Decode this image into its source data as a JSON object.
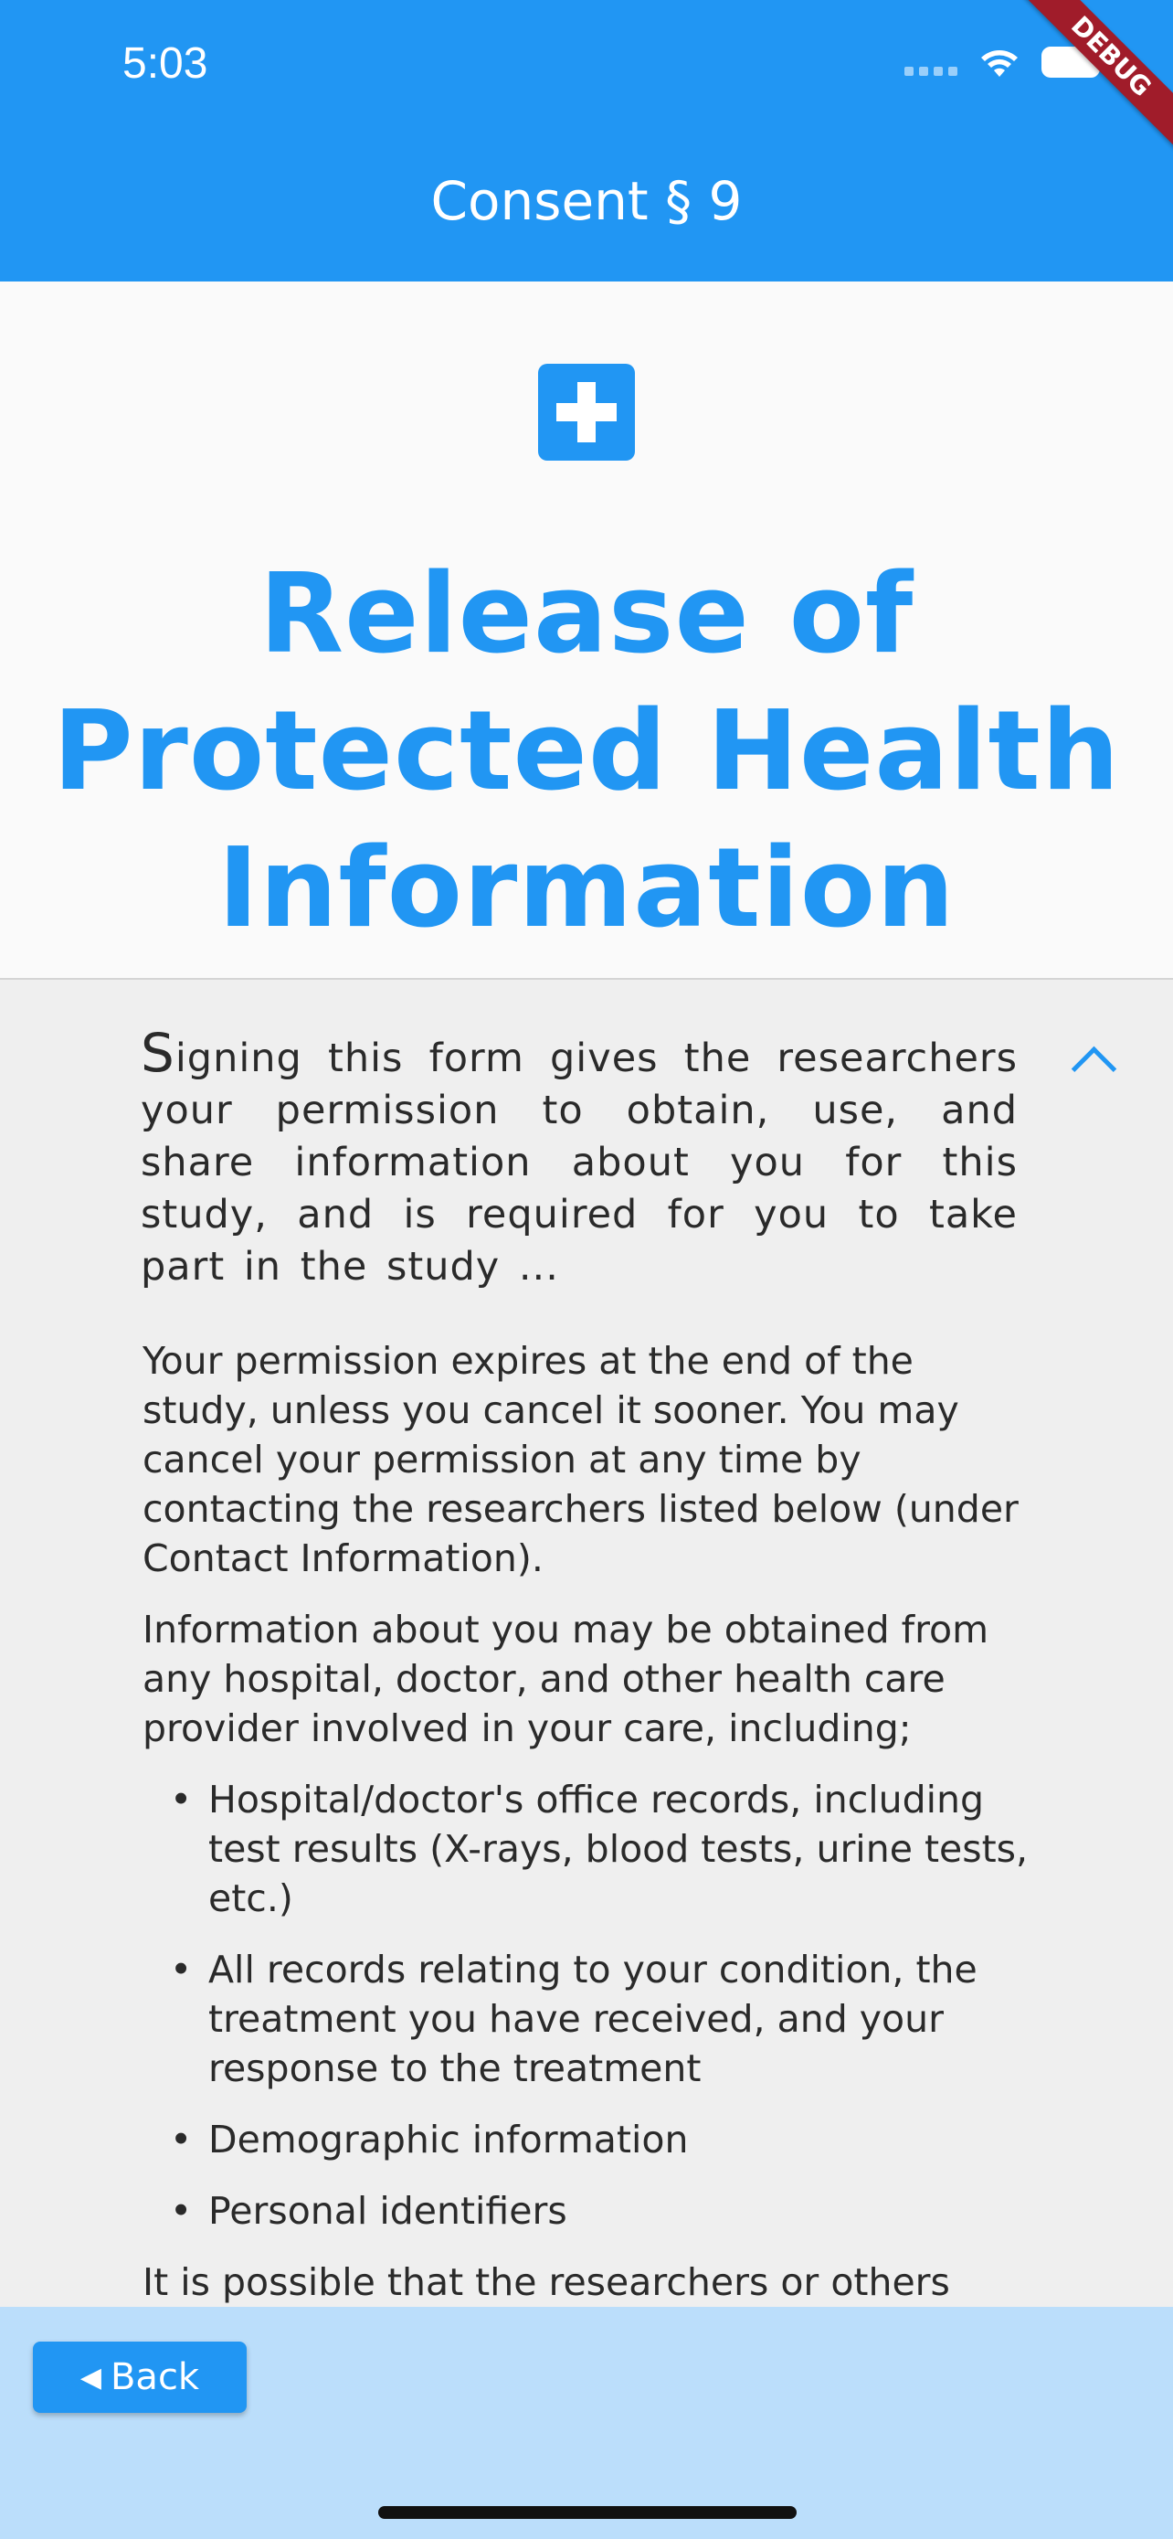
{
  "status_bar": {
    "time": "5:03",
    "debug_ribbon": "DEBUG",
    "icons": [
      "signal-icon",
      "wifi-icon",
      "battery-icon"
    ]
  },
  "app_bar": {
    "title": "Consent § 9"
  },
  "header": {
    "icon": "medical-plus-icon",
    "title": "Release of Protected Health Information"
  },
  "summary": {
    "first_letter": "S",
    "rest": "igning this form gives the researchers your permission to obtain, use, and share information about you for this study, and is required for you to take part in the study ...",
    "toggle_icon": "chevron-up-icon"
  },
  "body": {
    "paragraph1": "Your permission expires at the end of the study, unless you cancel it sooner. You may cancel your permission at any time by contacting the researchers listed below (under Contact Information).",
    "paragraph2": "Information about you may be obtained from any hospital, doctor, and other health care provider involved in your care, including;",
    "bullets": [
      "Hospital/doctor's office records, including test results (X-rays, blood tests, urine tests, etc.)",
      "All records relating to your condition, the treatment you have received, and your response to the treatment",
      "Demographic information",
      "Personal identifiers"
    ],
    "paragraph3": "It is possible that the researchers or others"
  },
  "footer": {
    "back_label": "Back",
    "back_icon": "left-triangle-icon"
  },
  "colors": {
    "primary": "#2196f3",
    "footer_bg": "#bbdefb",
    "debug": "#a01c2a"
  }
}
